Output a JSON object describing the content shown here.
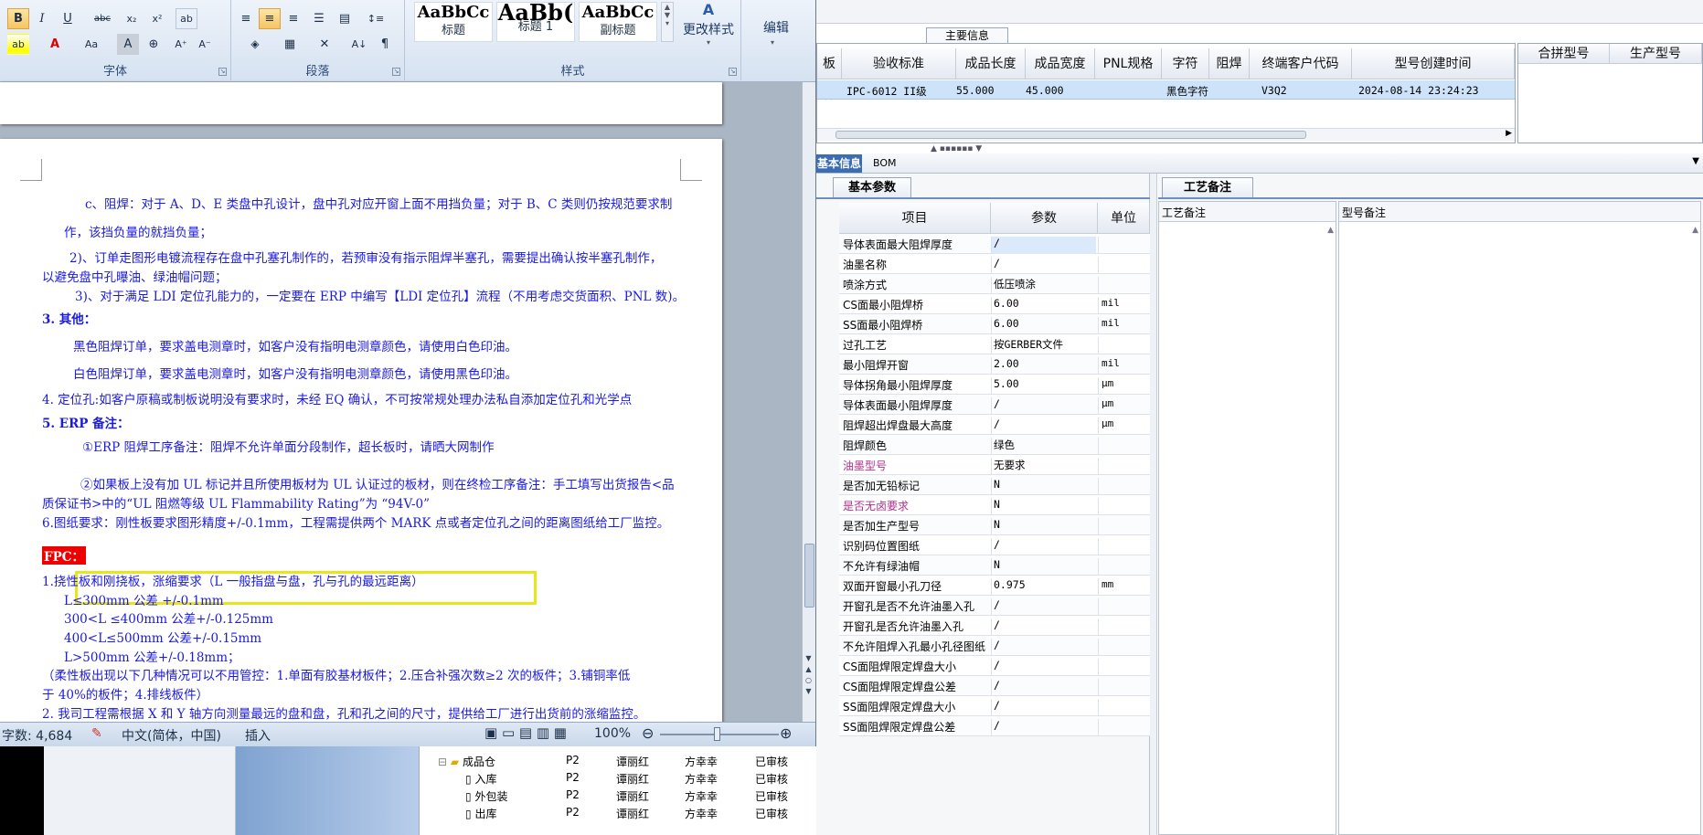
{
  "ribbon": {
    "font_group": "字体",
    "para_group": "段落",
    "style_group": "样式",
    "styles": [
      {
        "sample": "AaBbCc",
        "name": "标题"
      },
      {
        "sample": "AaBb(",
        "name": "标题 1"
      },
      {
        "sample": "AaBbCc",
        "name": "副标题"
      }
    ],
    "change_styles": "更改样式",
    "edit": "编辑"
  },
  "document": {
    "lines": [
      "c、阻焊：对于 A、D、E 类盘中孔设计，盘中孔对应开窗上面不用挡负量；对于 B、C 类则仍按规范要求制",
      "作，该挡负量的就挡负量；",
      "2)、订单走图形电镀流程存在盘中孔塞孔制作的，若预审没有指示阻焊半塞孔，需要提出确认按半塞孔制作，",
      "以避免盘中孔曝油、绿油帽问题；",
      "3)、对于满足 LDI 定位孔能力的，一定要在 ERP 中编写【LDI 定位孔】流程（不用考虑交货面积、PNL 数)。",
      "3. 其他：",
      "黑色阻焊订单，要求盖电测章时，如客户没有指明电测章颜色，请使用白色印油。",
      "白色阻焊订单，要求盖电测章时，如客户没有指明电测章颜色，请使用黑色印油。",
      "4. 定位孔:如客户原稿或制板说明没有要求时，未经 EQ 确认，不可按常规处理办法私自添加定位孔和光学点",
      "5. ERP 备注：",
      "①ERP 阻焊工序备注：阻焊不允许单面分段制作，超长板时，请晒大网制作",
      "②如果板上没有加 UL 标记并且所使用板材为 UL 认证过的板材，则在终检工序备注：手工填写出货报告<品",
      "质保证书>中的“UL 阻燃等级 UL Flammability Rating”为 “94V-0”",
      "6.图纸要求：刚性板要求图形精度+/-0.1mm，工程需提供两个 MARK 点或者定位孔之间的距离图纸给工厂监控。",
      "FPC：",
      "1.挠性板和刚挠板，涨缩要求（L 一般指盘与盘，孔与孔的最远距离）",
      "L≤300mm 公差 +/-0.1mm",
      "300<L ≤400mm 公差+/-0.125mm",
      "400<L≤500mm 公差+/-0.15mm",
      "L>500mm 公差+/-0.18mm；",
      "（柔性板出现以下几种情况可以不用管控：1.单面有胶基材板件；2.压合补强次数≥2 次的板件；3.铺铜率低",
      "于 40%的板件；4.排线板件）",
      "2.   我司工程需根据 X 和 Y 轴方向测量最远的盘和盘，孔和孔之间的尺寸，提供给工厂进行出货前的涨缩监控。"
    ]
  },
  "statusbar": {
    "word_count": "字数: 4,684",
    "language": "中文(简体，中国)",
    "mode": "插入",
    "zoom": "100%"
  },
  "erp": {
    "main_info_tab": "主要信息",
    "columns": [
      "板材",
      "验收标准",
      "成品长度",
      "成品宽度",
      "PNL规格",
      "字符",
      "阻焊",
      "终端客户代码",
      "型号创建时间"
    ],
    "row": [
      "",
      "IPC-6012 II级",
      "55.000",
      "45.000",
      "",
      "黑色字符",
      "",
      "V3Q2",
      "2024-08-14 23:24:23"
    ],
    "right_columns": [
      "合拼型号",
      "生产型号"
    ],
    "tabs": [
      "基本信息",
      "BOM"
    ],
    "params_tab": "基本参数",
    "param_headers": [
      "项目",
      "参数",
      "单位"
    ],
    "params": [
      {
        "name": "导体表面最大阻焊厚度",
        "value": "/",
        "unit": ""
      },
      {
        "name": "油墨名称",
        "value": "/",
        "unit": ""
      },
      {
        "name": "喷涂方式",
        "value": "低压喷涂",
        "unit": ""
      },
      {
        "name": "CS面最小阻焊桥",
        "value": "6.00",
        "unit": "mil"
      },
      {
        "name": "SS面最小阻焊桥",
        "value": "6.00",
        "unit": "mil"
      },
      {
        "name": "过孔工艺",
        "value": "按GERBER文件",
        "unit": ""
      },
      {
        "name": "最小阻焊开窗",
        "value": "2.00",
        "unit": "mil"
      },
      {
        "name": "导体拐角最小阻焊厚度",
        "value": "5.00",
        "unit": "μm"
      },
      {
        "name": "导体表面最小阻焊厚度",
        "value": "/",
        "unit": "μm"
      },
      {
        "name": "阻焊超出焊盘最大高度",
        "value": "/",
        "unit": "μm"
      },
      {
        "name": "阻焊颜色",
        "value": "绿色",
        "unit": ""
      },
      {
        "name": "油墨型号",
        "value": "无要求",
        "unit": ""
      },
      {
        "name": "是否加无铅标记",
        "value": "N",
        "unit": ""
      },
      {
        "name": "是否无卤要求",
        "value": "N",
        "unit": ""
      },
      {
        "name": "是否加生产型号",
        "value": "N",
        "unit": ""
      },
      {
        "name": "识别码位置图纸",
        "value": "/",
        "unit": ""
      },
      {
        "name": "不允许有绿油帽",
        "value": "N",
        "unit": ""
      },
      {
        "name": "双面开窗最小孔刀径",
        "value": "0.975",
        "unit": "mm"
      },
      {
        "name": "开窗孔是否不允许油墨入孔",
        "value": "/",
        "unit": ""
      },
      {
        "name": "开窗孔是否允许油墨入孔",
        "value": "/",
        "unit": ""
      },
      {
        "name": "不允许阻焊入孔最小孔径图纸",
        "value": "/",
        "unit": ""
      },
      {
        "name": "CS面阻焊限定焊盘大小",
        "value": "/",
        "unit": ""
      },
      {
        "name": "CS面阻焊限定焊盘公差",
        "value": "/",
        "unit": ""
      },
      {
        "name": "SS面阻焊限定焊盘大小",
        "value": "/",
        "unit": ""
      },
      {
        "name": "SS面阻焊限定焊盘公差",
        "value": "/",
        "unit": ""
      }
    ],
    "craft_tab": "工艺备注",
    "craft_col": "工艺备注",
    "model_col": "型号备注",
    "tree": [
      {
        "label": "成品仓",
        "c1": "P2",
        "c2": "谭丽红",
        "c3": "方幸幸",
        "c4": "已审核"
      },
      {
        "label": "入库",
        "c1": "P2",
        "c2": "谭丽红",
        "c3": "方幸幸",
        "c4": "已审核"
      },
      {
        "label": "外包装",
        "c1": "P2",
        "c2": "谭丽红",
        "c3": "方幸幸",
        "c4": "已审核"
      },
      {
        "label": "出库",
        "c1": "P2",
        "c2": "谭丽红",
        "c3": "方幸幸",
        "c4": "已审核"
      }
    ]
  }
}
